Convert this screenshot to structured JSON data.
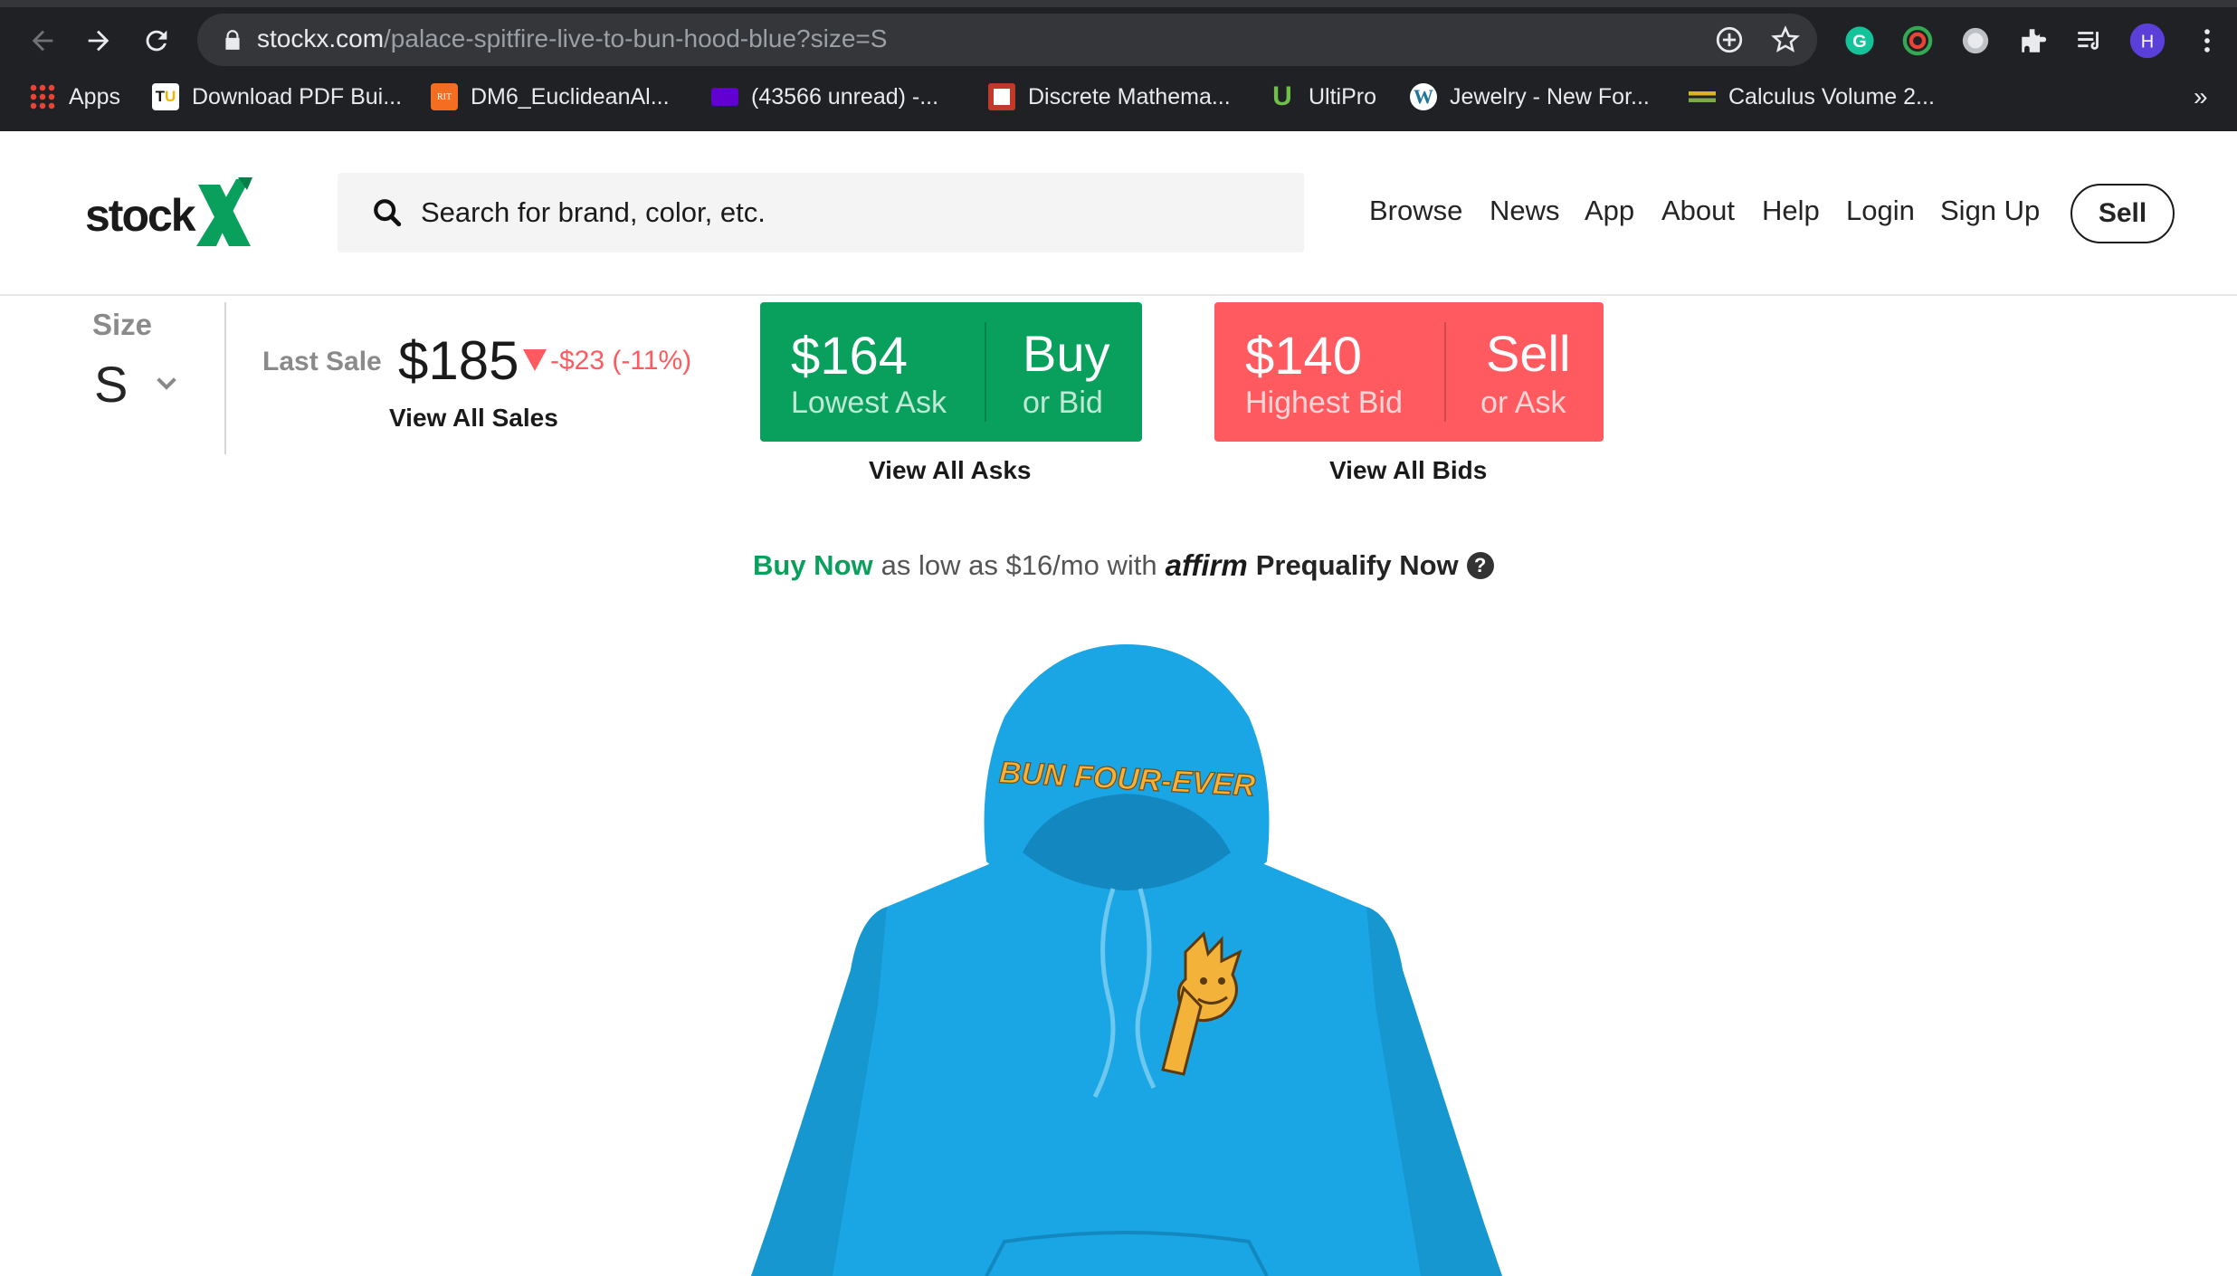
{
  "browser": {
    "url_domain": "stockx.com",
    "url_path": "/palace-spitfire-live-to-bun-hood-blue?size=S",
    "profile_initial": "H",
    "bookmarks": [
      {
        "label": "Apps",
        "icon": "apps-grid-icon"
      },
      {
        "label": "Download PDF Bui...",
        "icon": "tu-icon"
      },
      {
        "label": "DM6_EuclideanAl...",
        "icon": "rit-icon"
      },
      {
        "label": "(43566 unread) -...",
        "icon": "mail-icon"
      },
      {
        "label": "Discrete Mathema...",
        "icon": "book-icon"
      },
      {
        "label": "UltiPro",
        "icon": "ultipro-icon"
      },
      {
        "label": "Jewelry - New For...",
        "icon": "wordpress-icon"
      },
      {
        "label": "Calculus Volume 2...",
        "icon": "books-icon"
      }
    ],
    "more_label": "»"
  },
  "header": {
    "logo_text": "stock",
    "logo_x": "X",
    "search_placeholder": "Search for brand, color, etc.",
    "nav": [
      "Browse",
      "News",
      "App",
      "About",
      "Help",
      "Login",
      "Sign Up"
    ],
    "sell_label": "Sell"
  },
  "product": {
    "size_label": "Size",
    "size_value": "S",
    "last_sale_label": "Last Sale",
    "last_sale_price": "$185",
    "last_sale_change": "-$23 (-11%)",
    "view_all_sales": "View All Sales",
    "lowest_ask": "$164",
    "lowest_ask_label": "Lowest Ask",
    "buy_label": "Buy",
    "buy_sub": "or Bid",
    "view_all_asks": "View All Asks",
    "highest_bid": "$140",
    "highest_bid_label": "Highest Bid",
    "sell_label": "Sell",
    "sell_sub": "or Ask",
    "view_all_bids": "View All Bids",
    "affirm_buy_now": "Buy Now",
    "affirm_text": "as low as $16/mo with",
    "affirm_brand": "affirm",
    "affirm_prequalify": "Prequalify Now",
    "hood_print": "BUN FOUR-EVER"
  },
  "colors": {
    "buy_green": "#08a05c",
    "sell_red": "#ff5a5f",
    "hoodie_blue": "#1aa6e4"
  }
}
